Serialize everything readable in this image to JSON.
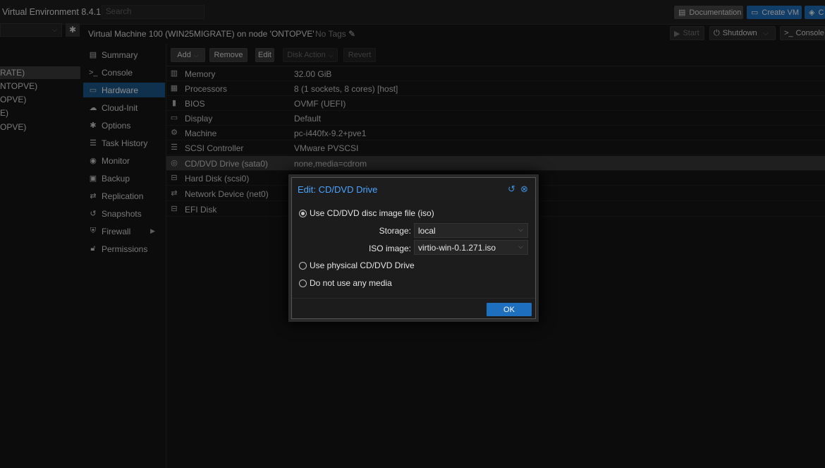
{
  "topbar": {
    "brand": "Virtual Environment 8.4.1",
    "search_placeholder": "Search",
    "buttons": [
      {
        "label": "Documentation",
        "icon": "book-icon"
      },
      {
        "label": "Create VM",
        "icon": "monitor-icon"
      },
      {
        "label": "C",
        "icon": "cube-icon"
      }
    ]
  },
  "header": {
    "vm_title": "Virtual Machine 100 (WIN25MIGRATE) on node 'ONTOPVE'",
    "tags_label": "No Tags",
    "buttons": {
      "start": "Start",
      "shutdown": "Shutdown",
      "console": "Console"
    }
  },
  "tree": {
    "items": [
      {
        "label": "RATE)",
        "selected": true
      },
      {
        "label": "NTOPVE)",
        "selected": false
      },
      {
        "label": "OPVE)",
        "selected": false
      },
      {
        "label": "E)",
        "selected": false
      },
      {
        "label": "OPVE)",
        "selected": false
      }
    ]
  },
  "menu": {
    "items": [
      {
        "label": "Summary",
        "icon": "book-icon"
      },
      {
        "label": "Console",
        "icon": "terminal-icon"
      },
      {
        "label": "Hardware",
        "icon": "monitor-icon",
        "selected": true
      },
      {
        "label": "Cloud-Init",
        "icon": "cloud-icon"
      },
      {
        "label": "Options",
        "icon": "gear-icon"
      },
      {
        "label": "Task History",
        "icon": "list-icon"
      },
      {
        "label": "Monitor",
        "icon": "eye-icon"
      },
      {
        "label": "Backup",
        "icon": "floppy-icon"
      },
      {
        "label": "Replication",
        "icon": "retweet-icon"
      },
      {
        "label": "Snapshots",
        "icon": "history-icon"
      },
      {
        "label": "Firewall",
        "icon": "shield-icon"
      },
      {
        "label": "Permissions",
        "icon": "unlock-icon"
      }
    ]
  },
  "hardware": {
    "toolbar": {
      "add": "Add",
      "remove": "Remove",
      "edit": "Edit",
      "disk_action": "Disk Action",
      "revert": "Revert"
    },
    "rows": [
      {
        "icon": "memory-icon",
        "name": "Memory",
        "value": "32.00 GiB"
      },
      {
        "icon": "cpu-icon",
        "name": "Processors",
        "value": "8 (1 sockets, 8 cores) [host]"
      },
      {
        "icon": "microchip-icon",
        "name": "BIOS",
        "value": "OVMF (UEFI)"
      },
      {
        "icon": "desktop-icon",
        "name": "Display",
        "value": "Default"
      },
      {
        "icon": "cogs-icon",
        "name": "Machine",
        "value": "pc-i440fx-9.2+pve1"
      },
      {
        "icon": "database-icon",
        "name": "SCSI Controller",
        "value": "VMware PVSCSI"
      },
      {
        "icon": "cdrom-icon",
        "name": "CD/DVD Drive (sata0)",
        "value": "none,media=cdrom",
        "selected": true
      },
      {
        "icon": "hdd-icon",
        "name": "Hard Disk (scsi0)",
        "value": ""
      },
      {
        "icon": "exchange-icon",
        "name": "Network Device (net0)",
        "value": ""
      },
      {
        "icon": "hdd-icon",
        "name": "EFI Disk",
        "value": ""
      }
    ]
  },
  "dialog": {
    "title": "Edit: CD/DVD Drive",
    "option_iso": "Use CD/DVD disc image file (iso)",
    "storage_label": "Storage:",
    "storage_value": "local",
    "iso_label": "ISO image:",
    "iso_value": "virtio-win-0.1.271.iso",
    "option_physical": "Use physical CD/DVD Drive",
    "option_none": "Do not use any media",
    "ok_label": "OK"
  }
}
